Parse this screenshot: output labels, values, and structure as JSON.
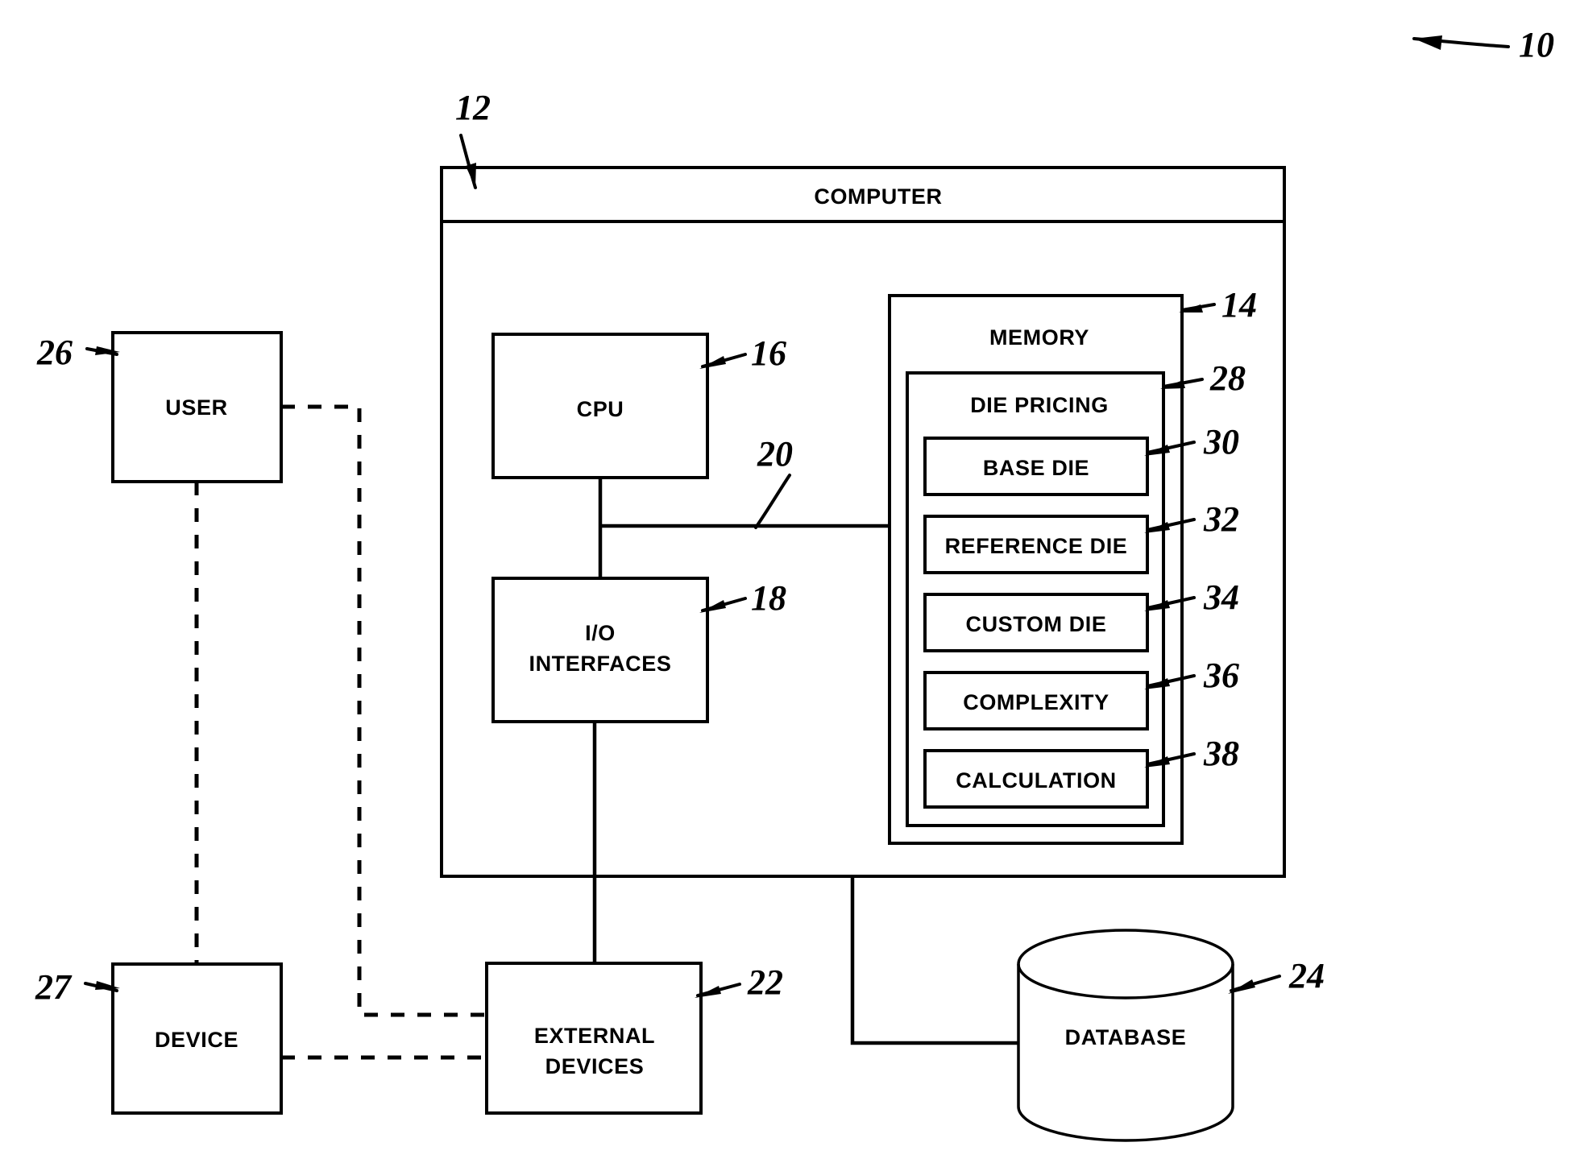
{
  "figure": {
    "top_ref": "10",
    "nodes": {
      "computer": {
        "label": "COMPUTER",
        "ref": "12"
      },
      "cpu": {
        "label": "CPU",
        "ref": "16"
      },
      "io": {
        "label_line1": "I/O",
        "label_line2": "INTERFACES",
        "ref": "18"
      },
      "bus": {
        "ref": "20"
      },
      "memory": {
        "label": "MEMORY",
        "ref": "14"
      },
      "die_pricing": {
        "label": "DIE PRICING",
        "ref": "28"
      },
      "base_die": {
        "label": "BASE DIE",
        "ref": "30"
      },
      "reference_die": {
        "label": "REFERENCE DIE",
        "ref": "32"
      },
      "custom_die": {
        "label": "CUSTOM DIE",
        "ref": "34"
      },
      "complexity": {
        "label": "COMPLEXITY",
        "ref": "36"
      },
      "calculation": {
        "label": "CALCULATION",
        "ref": "38"
      },
      "user": {
        "label": "USER",
        "ref": "26"
      },
      "device": {
        "label": "DEVICE",
        "ref": "27"
      },
      "external_devices": {
        "label_line1": "EXTERNAL",
        "label_line2": "DEVICES",
        "ref": "22"
      },
      "database": {
        "label": "DATABASE",
        "ref": "24"
      }
    },
    "colors": {
      "ink": "#000000",
      "paper": "#ffffff"
    }
  }
}
